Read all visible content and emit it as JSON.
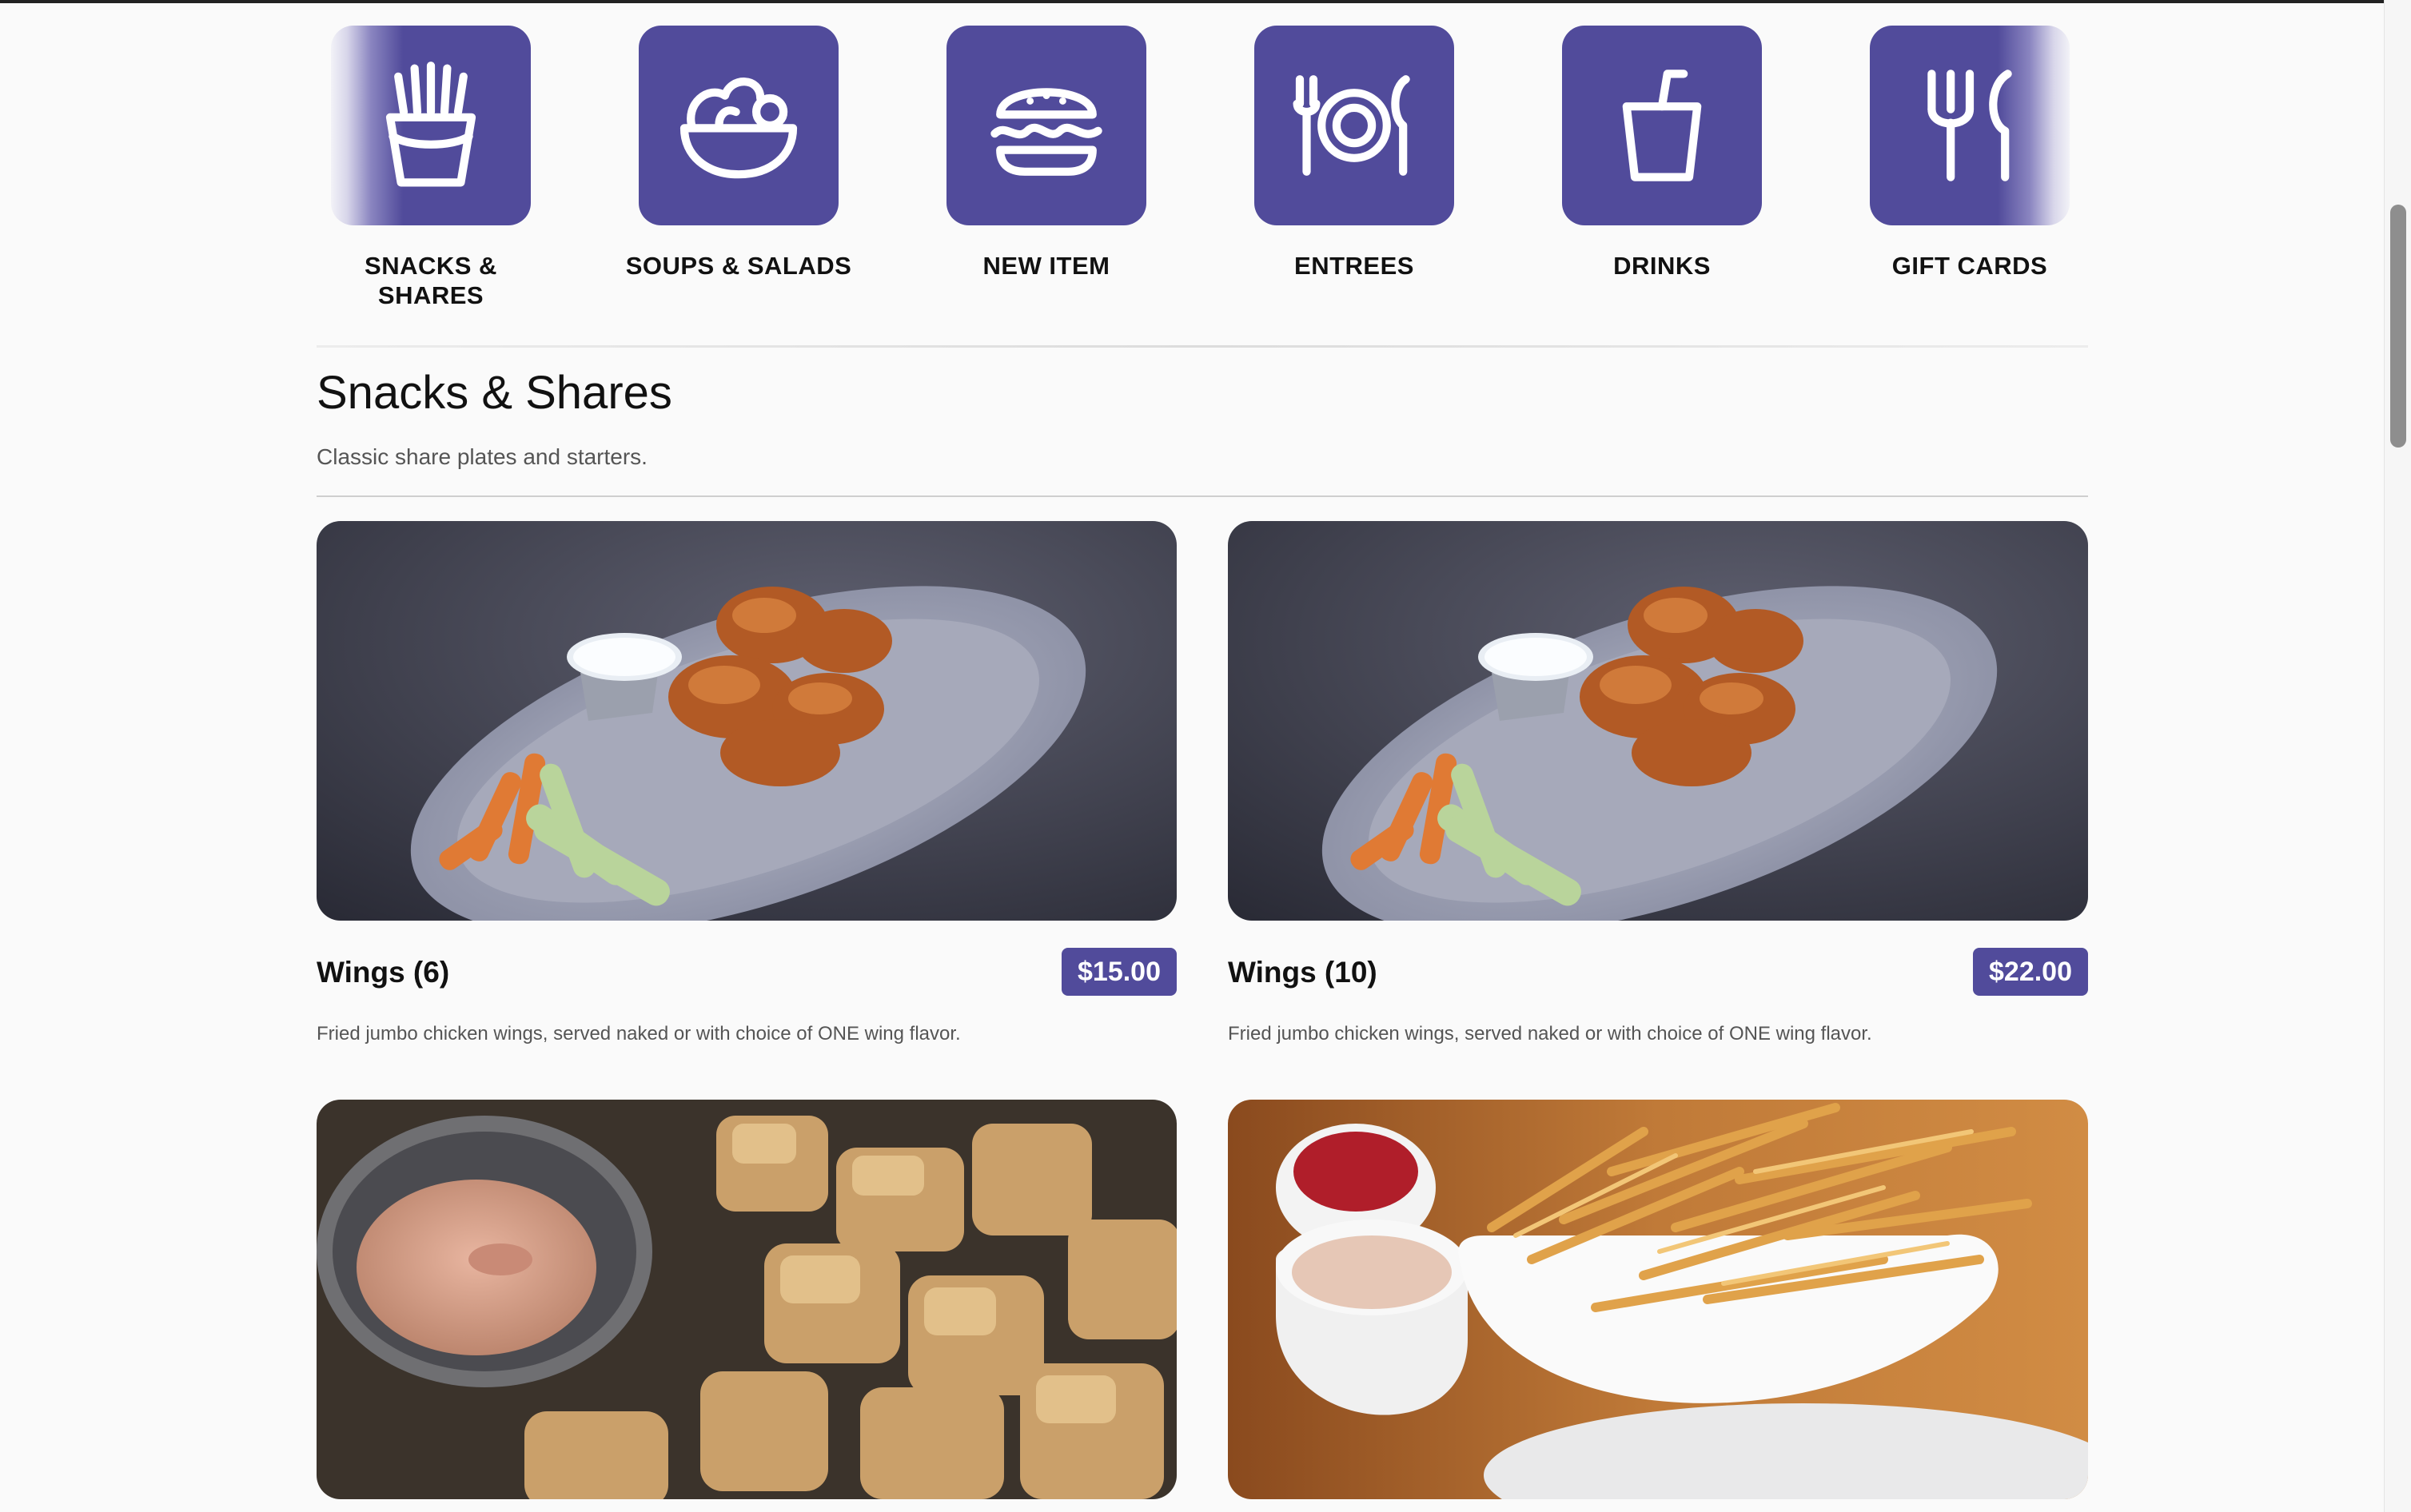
{
  "categories": [
    {
      "label": "SNACKS &\nSHARES",
      "icon": "fries-icon"
    },
    {
      "label": "SOUPS & SALADS",
      "icon": "salad-bowl-icon"
    },
    {
      "label": "NEW ITEM",
      "icon": "burger-icon"
    },
    {
      "label": "ENTREES",
      "icon": "plate-fork-knife-icon"
    },
    {
      "label": "DRINKS",
      "icon": "drink-cup-icon"
    },
    {
      "label": "GIFT CARDS",
      "icon": "fork-knife-icon"
    }
  ],
  "section": {
    "title": "Snacks & Shares",
    "description": "Classic share plates and starters."
  },
  "items": [
    {
      "name": "Wings (6)",
      "price": "$15.00",
      "description": "Fried jumbo chicken wings, served naked or with choice of ONE wing flavor.",
      "image": "wings-photo"
    },
    {
      "name": "Wings (10)",
      "price": "$22.00",
      "description": "Fried jumbo chicken wings, served naked or with choice of ONE wing flavor.",
      "image": "wings-photo"
    },
    {
      "name": "",
      "price": "",
      "description": "",
      "image": "tots-photo"
    },
    {
      "name": "",
      "price": "",
      "description": "",
      "image": "fries-photo"
    }
  ],
  "colors": {
    "brand": "#514b9b",
    "background": "#fafafa",
    "text": "#111111",
    "muted": "#555555"
  }
}
